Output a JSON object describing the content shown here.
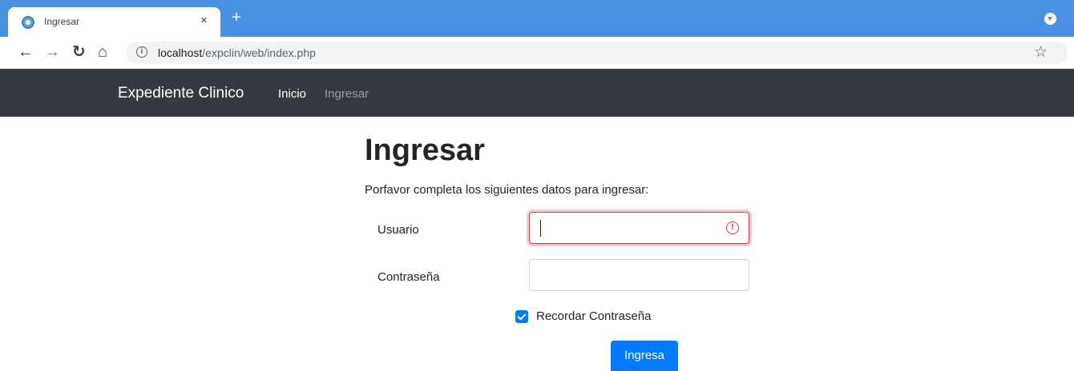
{
  "browser": {
    "tab_title": "Ingresar",
    "tab_close": "×",
    "new_tab": "+",
    "url_host": "localhost",
    "url_path": "/expclin/web/index.php"
  },
  "navbar": {
    "brand": "Expediente Clinico",
    "links": [
      "Inicio",
      "Ingresar"
    ]
  },
  "page": {
    "title": "Ingresar",
    "intro": "Porfavor completa los siguientes datos para ingresar:"
  },
  "form": {
    "username_label": "Usuario",
    "username_value": "",
    "password_label": "Contraseña",
    "password_value": "",
    "remember_label": "Recordar Contraseña",
    "remember_checked": true,
    "submit_label": "Ingresa"
  },
  "colors": {
    "tabstrip": "#4a90e2",
    "navbar": "#343a40",
    "primary": "#007bff",
    "error": "#dc3545"
  },
  "icons": {
    "favicon": "site-favicon-icon",
    "back": "arrow-left-icon",
    "forward": "arrow-right-icon",
    "reload": "reload-icon",
    "home": "home-icon",
    "info": "info-icon",
    "bookmark": "star-icon",
    "error": "error-icon"
  }
}
